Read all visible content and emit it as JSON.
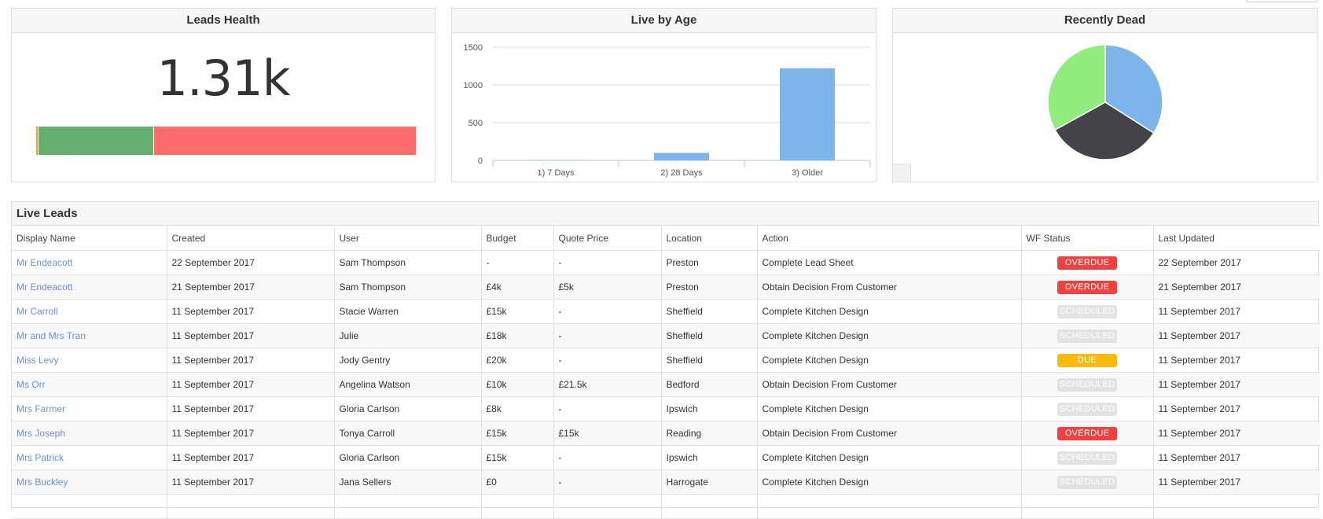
{
  "colors": {
    "overdue": "#f23f3f",
    "scheduled": "#e3e3e3",
    "due": "#fdbb09",
    "link": "#6f8fd3",
    "bar_blue": "#7cb5ec",
    "health_green": "#63b06f",
    "health_red": "#ff6b6b",
    "health_orange": "#f0a030"
  },
  "leads_health": {
    "title": "Leads Health",
    "value": "1.31k",
    "segments": [
      {
        "color": "#f0a030",
        "fraction": 0.004
      },
      {
        "color": "#63b06f",
        "fraction": 0.303
      },
      {
        "color": "#ff6b6b",
        "fraction": 0.693
      }
    ]
  },
  "live_by_age": {
    "title": "Live by Age"
  },
  "chart_data": [
    {
      "type": "bar",
      "title": "Live by Age",
      "categories": [
        "1) 7 Days",
        "2) 28 Days",
        "3) Older"
      ],
      "values": [
        5,
        100,
        1220
      ],
      "ylim": [
        0,
        1500
      ],
      "yticks": [
        0,
        500,
        1000,
        1500
      ],
      "grid": true,
      "color": "#7cb5ec"
    },
    {
      "type": "pie",
      "title": "Recently Dead",
      "values": [
        34,
        33,
        33
      ],
      "colors": [
        "#7cb5ec",
        "#434348",
        "#90ed7d"
      ]
    }
  ],
  "recently_dead": {
    "title": "Recently Dead"
  },
  "live_leads": {
    "title": "Live Leads",
    "columns": [
      "Display Name",
      "Created",
      "User",
      "Budget",
      "Quote Price",
      "Location",
      "Action",
      "WF Status",
      "Last Updated"
    ],
    "rows": [
      {
        "name": "Mr Endeacott",
        "created": "22 September 2017",
        "user": "Sam Thompson",
        "budget": "-",
        "quote": "-",
        "location": "Preston",
        "action": "Complete Lead Sheet",
        "status": "OVERDUE",
        "updated": "22 September 2017"
      },
      {
        "name": "Mr Endeacott",
        "created": "21 September 2017",
        "user": "Sam Thompson",
        "budget": "£4k",
        "quote": "£5k",
        "location": "Preston",
        "action": "Obtain Decision From Customer",
        "status": "OVERDUE",
        "updated": "21 September 2017"
      },
      {
        "name": "Mr Carroll",
        "created": "11 September 2017",
        "user": "Stacie Warren",
        "budget": "£15k",
        "quote": "-",
        "location": "Sheffield",
        "action": "Complete Kitchen Design",
        "status": "SCHEDULED",
        "updated": "11 September 2017"
      },
      {
        "name": "Mr and Mrs Tran",
        "created": "11 September 2017",
        "user": "Julie",
        "budget": "£18k",
        "quote": "-",
        "location": "Sheffield",
        "action": "Complete Kitchen Design",
        "status": "SCHEDULED",
        "updated": "11 September 2017"
      },
      {
        "name": "Miss Levy",
        "created": "11 September 2017",
        "user": "Jody Gentry",
        "budget": "£20k",
        "quote": "-",
        "location": "Sheffield",
        "action": "Complete Kitchen Design",
        "status": "DUE",
        "updated": "11 September 2017"
      },
      {
        "name": "Ms Orr",
        "created": "11 September 2017",
        "user": "Angelina Watson",
        "budget": "£10k",
        "quote": "£21.5k",
        "location": "Bedford",
        "action": "Obtain Decision From Customer",
        "status": "SCHEDULED",
        "updated": "11 September 2017"
      },
      {
        "name": "Mrs Farmer",
        "created": "11 September 2017",
        "user": "Gloria Carlson",
        "budget": "£8k",
        "quote": "-",
        "location": "Ipswich",
        "action": "Complete Kitchen Design",
        "status": "SCHEDULED",
        "updated": "11 September 2017"
      },
      {
        "name": "Mrs Joseph",
        "created": "11 September 2017",
        "user": "Tonya Carroll",
        "budget": "£15k",
        "quote": "£15k",
        "location": "Reading",
        "action": "Obtain Decision From Customer",
        "status": "OVERDUE",
        "updated": "11 September 2017"
      },
      {
        "name": "Mrs Patrick",
        "created": "11 September 2017",
        "user": "Gloria Carlson",
        "budget": "£15k",
        "quote": "-",
        "location": "Ipswich",
        "action": "Complete Kitchen Design",
        "status": "SCHEDULED",
        "updated": "11 September 2017"
      },
      {
        "name": "Mrs Buckley",
        "created": "11 September 2017",
        "user": "Jana Sellers",
        "budget": "£0",
        "quote": "-",
        "location": "Harrogate",
        "action": "Complete Kitchen Design",
        "status": "SCHEDULED",
        "updated": "11 September 2017"
      },
      {
        "name": "",
        "created": "",
        "user": "",
        "budget": "",
        "quote": "",
        "location": "",
        "action": "",
        "status": "",
        "updated": ""
      }
    ]
  }
}
